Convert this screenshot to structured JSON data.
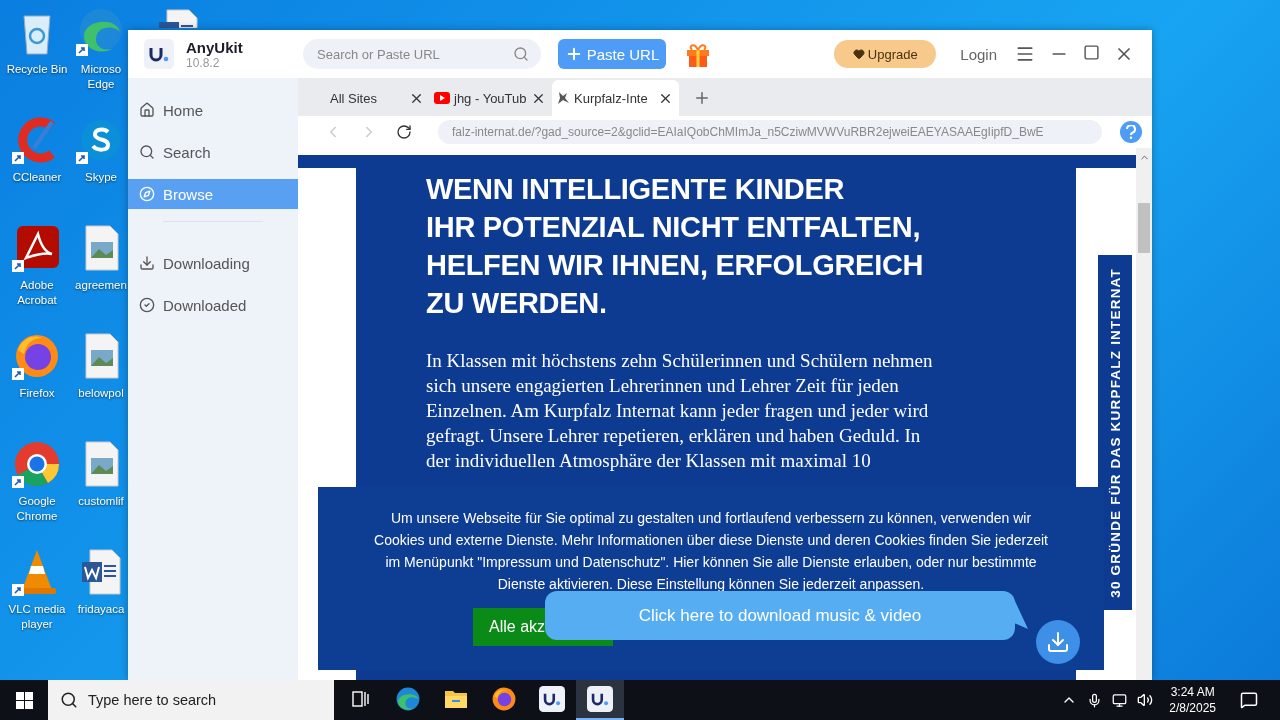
{
  "desktop": {
    "icons": [
      {
        "label": "Recycle Bin",
        "kind": "recycle-bin"
      },
      {
        "label": "CCleaner",
        "kind": "ccleaner"
      },
      {
        "label": "Adobe Acrobat",
        "kind": "acrobat"
      },
      {
        "label": "Firefox",
        "kind": "firefox"
      },
      {
        "label": "Google Chrome",
        "kind": "chrome"
      },
      {
        "label": "VLC media player",
        "kind": "vlc"
      },
      {
        "label": "Microso Edge",
        "kind": "edge"
      },
      {
        "label": "Skype",
        "kind": "skype"
      },
      {
        "label": "agreemen",
        "kind": "image-file"
      },
      {
        "label": "belowpol",
        "kind": "image-file"
      },
      {
        "label": "customlif",
        "kind": "image-file"
      },
      {
        "label": "fridayaca",
        "kind": "word-file"
      },
      {
        "kind": "word-file-top"
      }
    ]
  },
  "app": {
    "name": "AnyUkit",
    "version": "10.8.2",
    "search_placeholder": "Search or Paste URL",
    "paste_button": "Paste URL",
    "upgrade_button": "Upgrade",
    "login": "Login",
    "sidebar": {
      "nav": [
        {
          "label": "Home",
          "kind": "home",
          "selected": false
        },
        {
          "label": "Search",
          "kind": "search",
          "selected": false
        },
        {
          "label": "Browse",
          "kind": "browse",
          "selected": true
        }
      ],
      "downloads": [
        {
          "label": "Downloading",
          "kind": "downloading",
          "selected": false
        },
        {
          "label": "Downloaded",
          "kind": "downloaded",
          "selected": false
        }
      ]
    },
    "tabs": [
      {
        "label": "All Sites",
        "kind": "plain",
        "selected": false
      },
      {
        "label": "jhg - YouTub",
        "kind": "video",
        "selected": false
      },
      {
        "label": "Kurpfalz-Inte",
        "kind": "site",
        "selected": true
      }
    ],
    "address_bar": {
      "url": "falz-internat.de/?gad_source=2&gclid=EAIaIQobChMImJa_n5CziwMVWVuRBR2ejweiEAEYASAAEgIipfD_BwE"
    },
    "page": {
      "heading_lines": [
        "WENN INTELLIGENTE KINDER",
        "IHR POTENZIAL NICHT ENTFALTEN,",
        "HELFEN WIR IHNEN, ERFOLGREICH",
        "ZU WERDEN."
      ],
      "paragraph_lines": [
        "In Klassen mit höchstens zehn Schülerinnen und Schülern nehmen",
        "sich unsere engagierten Lehrerinnen und Lehrer Zeit für jeden",
        "Einzelnen. Am Kurpfalz Internat kann jeder fragen und jeder wird",
        "gefragt. Unsere Lehrer repetieren, erklären und haben Geduld. In",
        "der individuellen Atmosphäre der Klassen mit maximal 10"
      ],
      "side_tab": "30 GRÜNDE FÜR DAS KURPFALZ INTERNAT"
    },
    "cookie_banner": {
      "text_lines": [
        "Um unsere Webseite für Sie optimal zu gestalten und fortlaufend verbessern zu können, verwenden wir",
        "Cookies und externe Dienste. Mehr Informationen über diese Dienste und deren Cookies finden Sie jederzeit",
        "im Menüpunkt \"Impressum und Datenschutz\". Hier können Sie alle Dienste erlauben, oder nur bestimmte",
        "Dienste aktivieren. Diese Einstellung können Sie jederzeit anpassen."
      ],
      "accept_button": "Alle akz"
    },
    "download_popup": {
      "text": "Click here to download music & video"
    }
  },
  "taskbar": {
    "search_placeholder": "Type here to search",
    "apps": [
      {
        "kind": "task-view",
        "selected": false
      },
      {
        "kind": "edge",
        "selected": false
      },
      {
        "kind": "explorer",
        "selected": false
      },
      {
        "kind": "firefox",
        "selected": false
      },
      {
        "kind": "anyukit",
        "selected": false
      },
      {
        "kind": "anyukit",
        "selected": true
      }
    ],
    "time": "3:24 AM",
    "date": "2/8/2025"
  }
}
